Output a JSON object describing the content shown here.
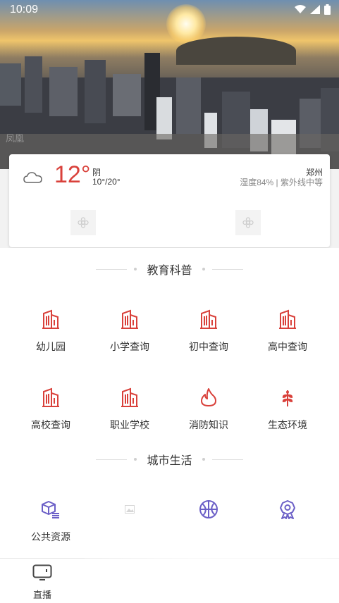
{
  "status_bar": {
    "time": "10:09"
  },
  "hero": {
    "watermark": "凤凰"
  },
  "weather": {
    "temperature": "12°",
    "condition": "阴",
    "range": "10°/20°",
    "city": "郑州",
    "details": "湿度84% | 紫外线中等"
  },
  "education": {
    "title": "教育科普",
    "items": [
      {
        "label": "幼儿园",
        "icon": "building-icon"
      },
      {
        "label": "小学查询",
        "icon": "building-icon"
      },
      {
        "label": "初中查询",
        "icon": "building-icon"
      },
      {
        "label": "高中查询",
        "icon": "building-icon"
      },
      {
        "label": "高校查询",
        "icon": "building-icon"
      },
      {
        "label": "职业学校",
        "icon": "building-icon"
      },
      {
        "label": "消防知识",
        "icon": "fire-icon"
      },
      {
        "label": "生态环境",
        "icon": "wheat-icon"
      }
    ]
  },
  "city_life": {
    "title": "城市生活",
    "items": [
      {
        "label": "公共资源",
        "icon": "cube-list-icon"
      },
      {
        "label": "",
        "icon": "image-placeholder-icon"
      },
      {
        "label": "",
        "icon": "basketball-icon"
      },
      {
        "label": "",
        "icon": "badge-icon"
      }
    ]
  },
  "bottom_nav": {
    "items": [
      {
        "label": "直播",
        "icon": "tv-icon"
      }
    ]
  },
  "colors": {
    "accent_red": "#d9413b",
    "icon_purple": "#6b5fc7"
  }
}
